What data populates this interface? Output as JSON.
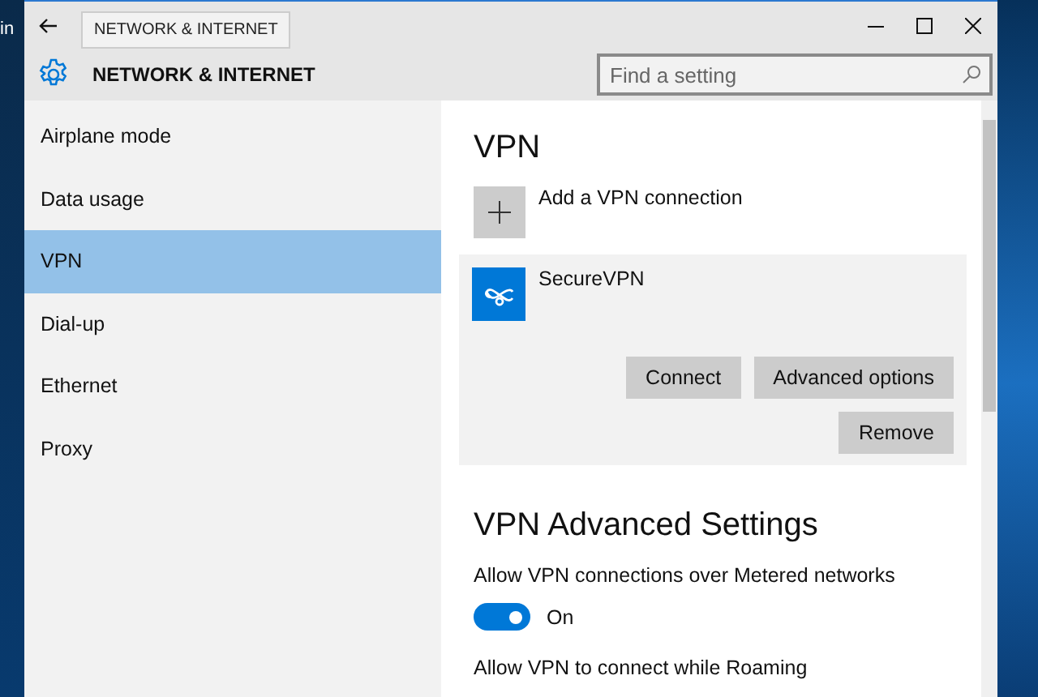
{
  "desktop": {
    "label": "in"
  },
  "window": {
    "tooltip": "NETWORK & INTERNET",
    "title": "NETWORK & INTERNET"
  },
  "search": {
    "placeholder": "Find a setting"
  },
  "sidebar": {
    "items": [
      {
        "label": "Airplane mode",
        "selected": false
      },
      {
        "label": "Data usage",
        "selected": false
      },
      {
        "label": "VPN",
        "selected": true
      },
      {
        "label": "Dial-up",
        "selected": false
      },
      {
        "label": "Ethernet",
        "selected": false
      },
      {
        "label": "Proxy",
        "selected": false
      }
    ]
  },
  "content": {
    "heading": "VPN",
    "add_label": "Add a VPN connection",
    "connections": [
      {
        "name": "SecureVPN",
        "buttons": [
          "Connect",
          "Advanced options"
        ],
        "remove": "Remove"
      }
    ],
    "advanced_heading": "VPN Advanced Settings",
    "settings": [
      {
        "label": "Allow VPN connections over Metered networks",
        "on": true,
        "state_label": "On"
      },
      {
        "label": "Allow VPN to connect while Roaming"
      }
    ]
  }
}
